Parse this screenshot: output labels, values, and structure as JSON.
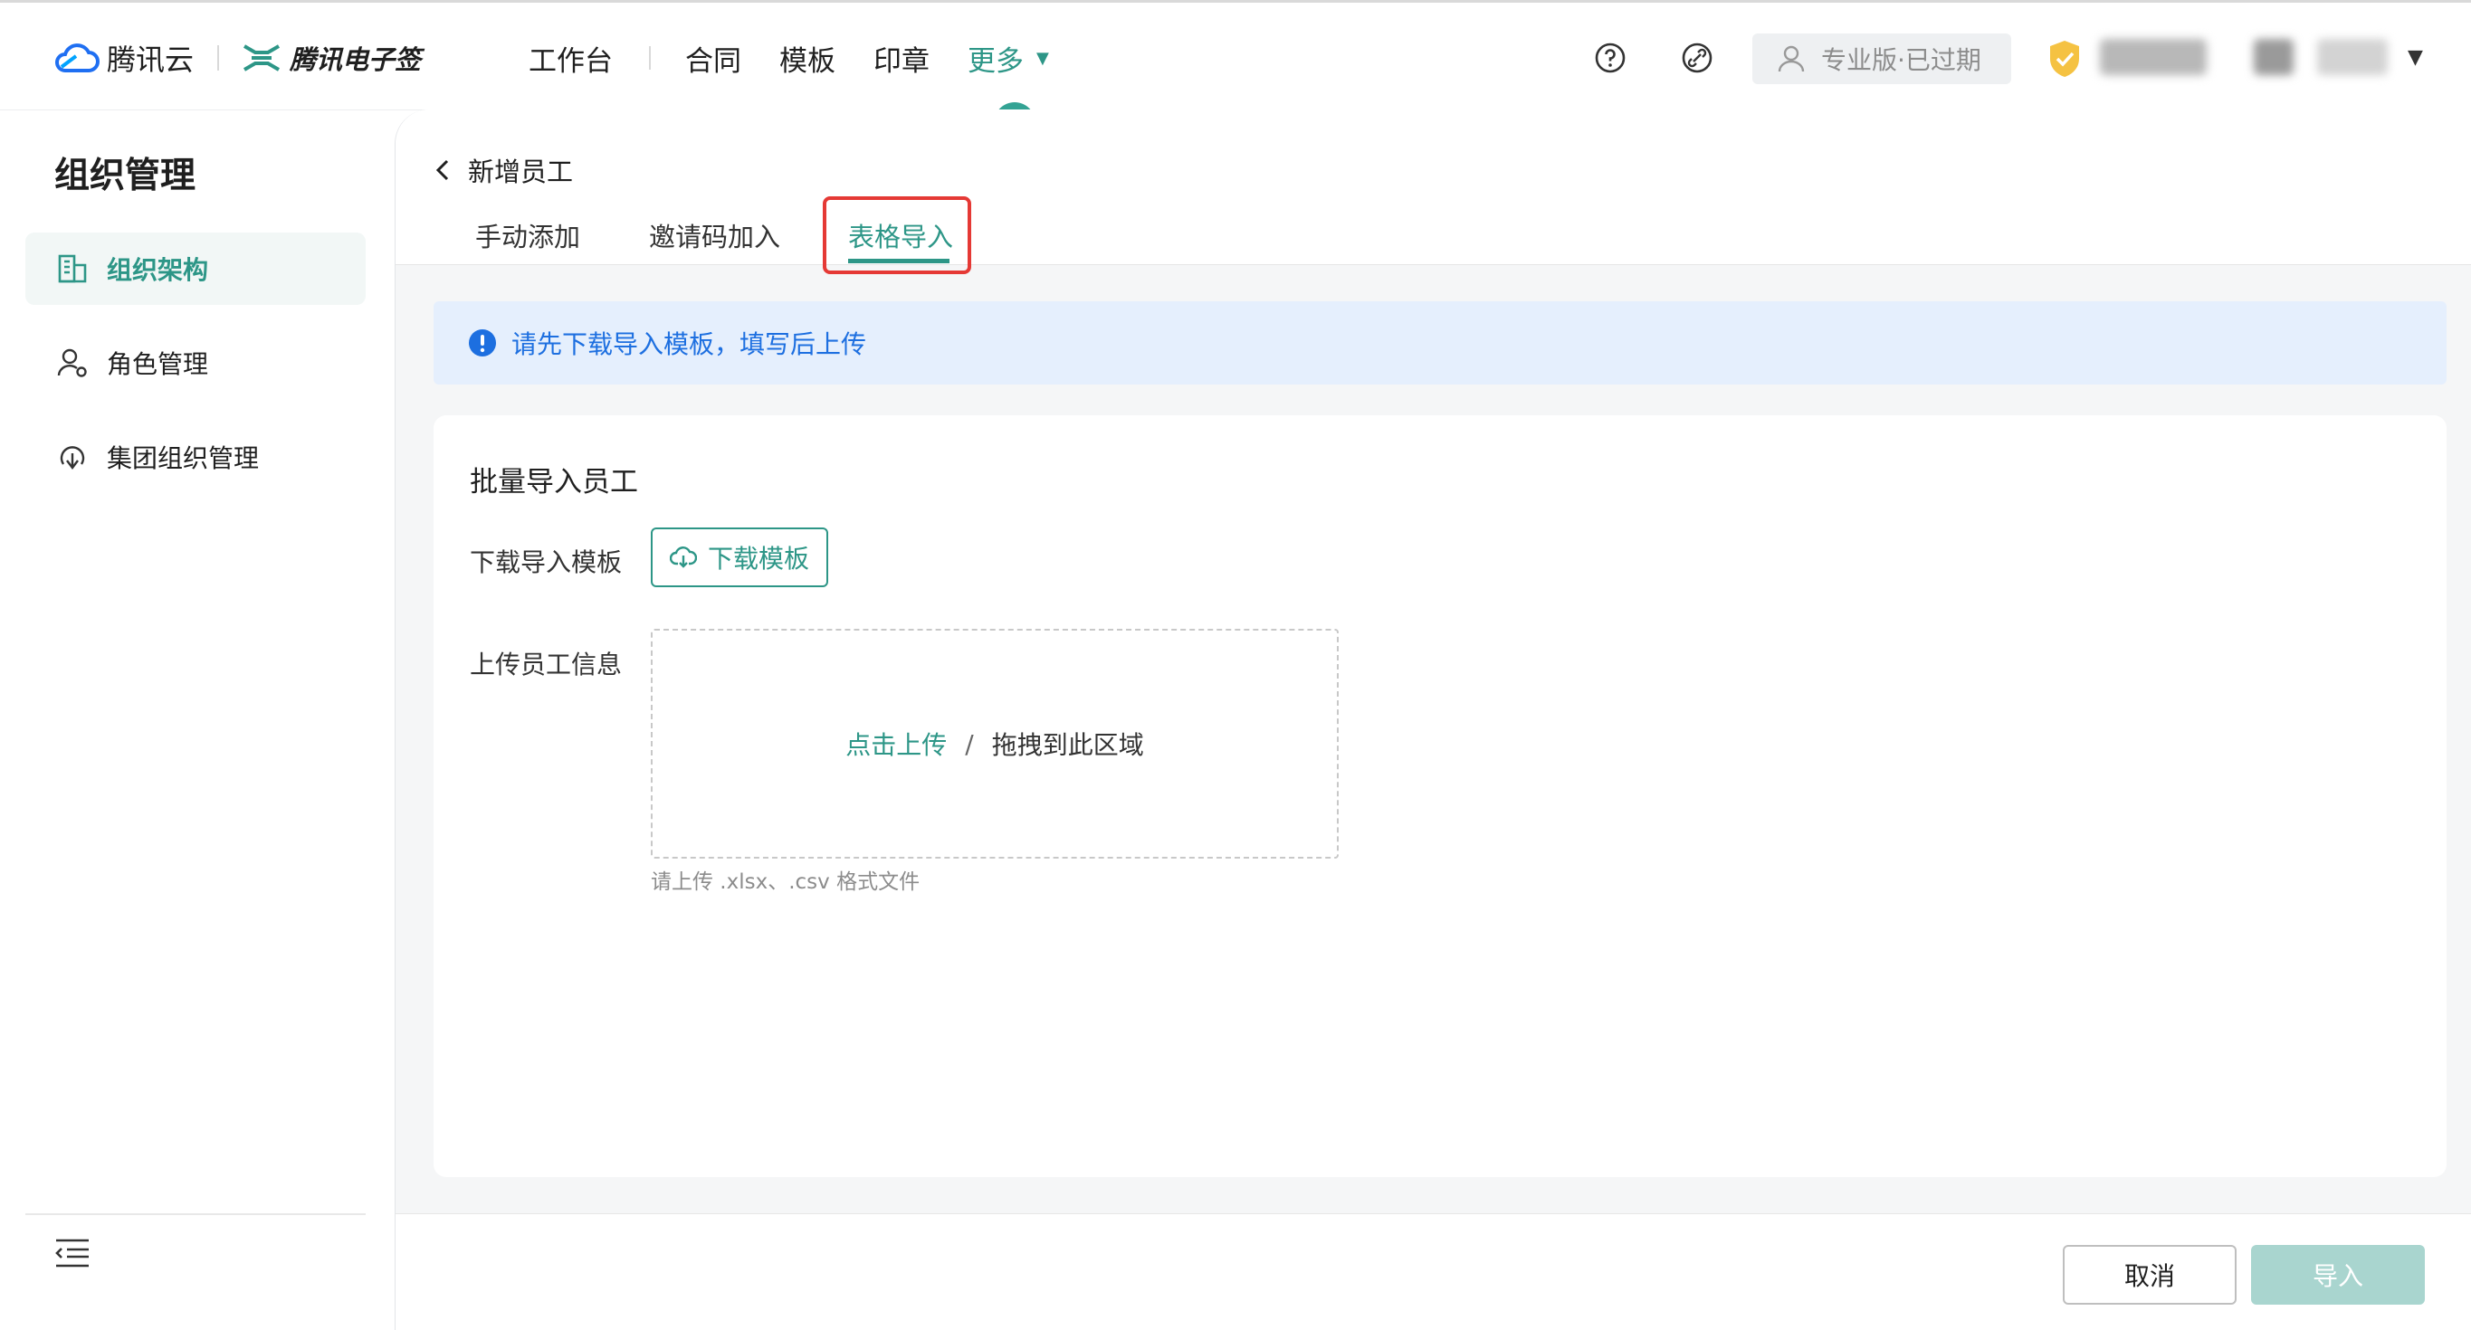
{
  "header": {
    "brand_name": "腾讯云",
    "product_name": "腾讯电子签",
    "nav": {
      "workbench": "工作台",
      "contracts": "合同",
      "templates": "模板",
      "seals": "印章",
      "more": "更多"
    },
    "plan_badge": "专业版·已过期"
  },
  "sidebar": {
    "title": "组织管理",
    "items": [
      {
        "label": "组织架构",
        "icon": "org-structure-icon",
        "active": true
      },
      {
        "label": "角色管理",
        "icon": "role-icon",
        "active": false
      },
      {
        "label": "集团组织管理",
        "icon": "group-org-icon",
        "active": false
      }
    ]
  },
  "main": {
    "page_title": "新增员工",
    "tabs": [
      {
        "label": "手动添加",
        "active": false
      },
      {
        "label": "邀请码加入",
        "active": false
      },
      {
        "label": "表格导入",
        "active": true
      }
    ],
    "alert": "请先下载导入模板，填写后上传",
    "card": {
      "title": "批量导入员工",
      "download_label": "下载导入模板",
      "download_button": "下载模板",
      "upload_label": "上传员工信息",
      "upload_link": "点击上传",
      "upload_separator": "/",
      "upload_drag": "拖拽到此区域",
      "upload_hint": "请上传 .xlsx、.csv 格式文件"
    },
    "footer": {
      "cancel": "取消",
      "import": "导入"
    }
  },
  "colors": {
    "brand": "#2d9687",
    "alert_text": "#1d6fe0",
    "alert_bg": "#e5effd",
    "highlight": "#e53935"
  }
}
